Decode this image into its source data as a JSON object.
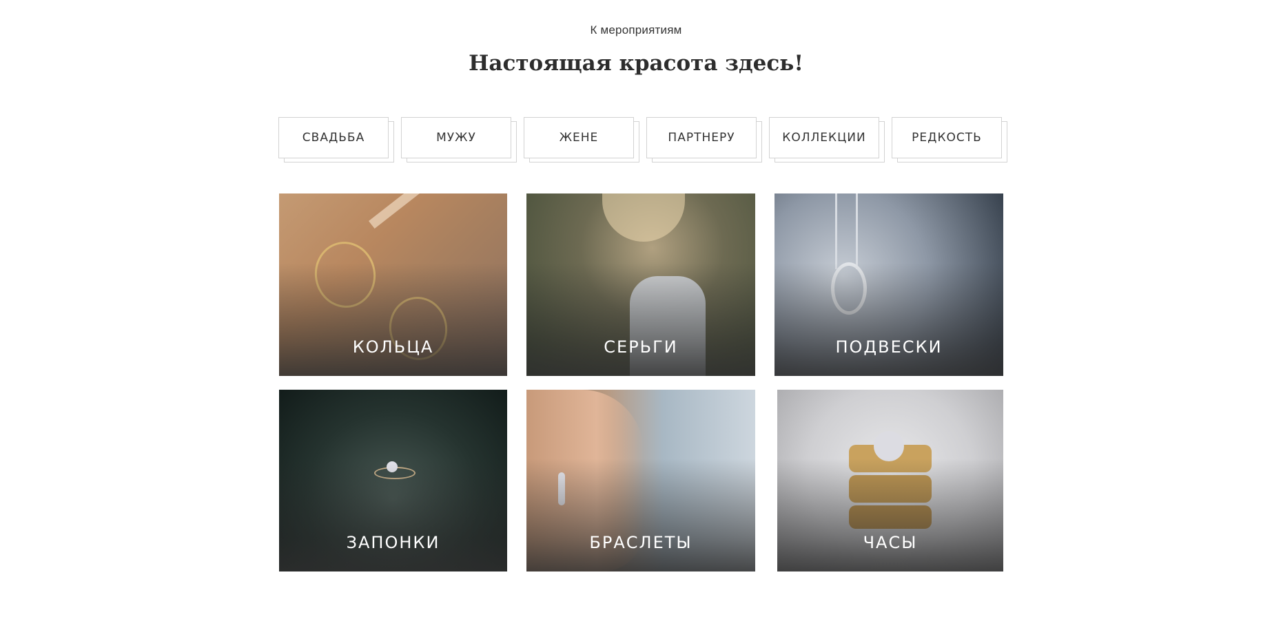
{
  "header": {
    "eyebrow": "К мероприятиям",
    "title": "Настоящая красота здесь!"
  },
  "filters": [
    {
      "label": "СВАДЬБА"
    },
    {
      "label": "МУЖУ"
    },
    {
      "label": "ЖЕНЕ"
    },
    {
      "label": "ПАРТНЕРУ"
    },
    {
      "label": "КОЛЛЕКЦИИ"
    },
    {
      "label": "РЕДКОСТЬ"
    }
  ],
  "categories": [
    {
      "label": "КОЛЬЦА"
    },
    {
      "label": "СЕРЬГИ"
    },
    {
      "label": "ПОДВЕСКИ"
    },
    {
      "label": "ЗАПОНКИ"
    },
    {
      "label": "БРАСЛЕТЫ"
    },
    {
      "label": "ЧАСЫ"
    }
  ]
}
